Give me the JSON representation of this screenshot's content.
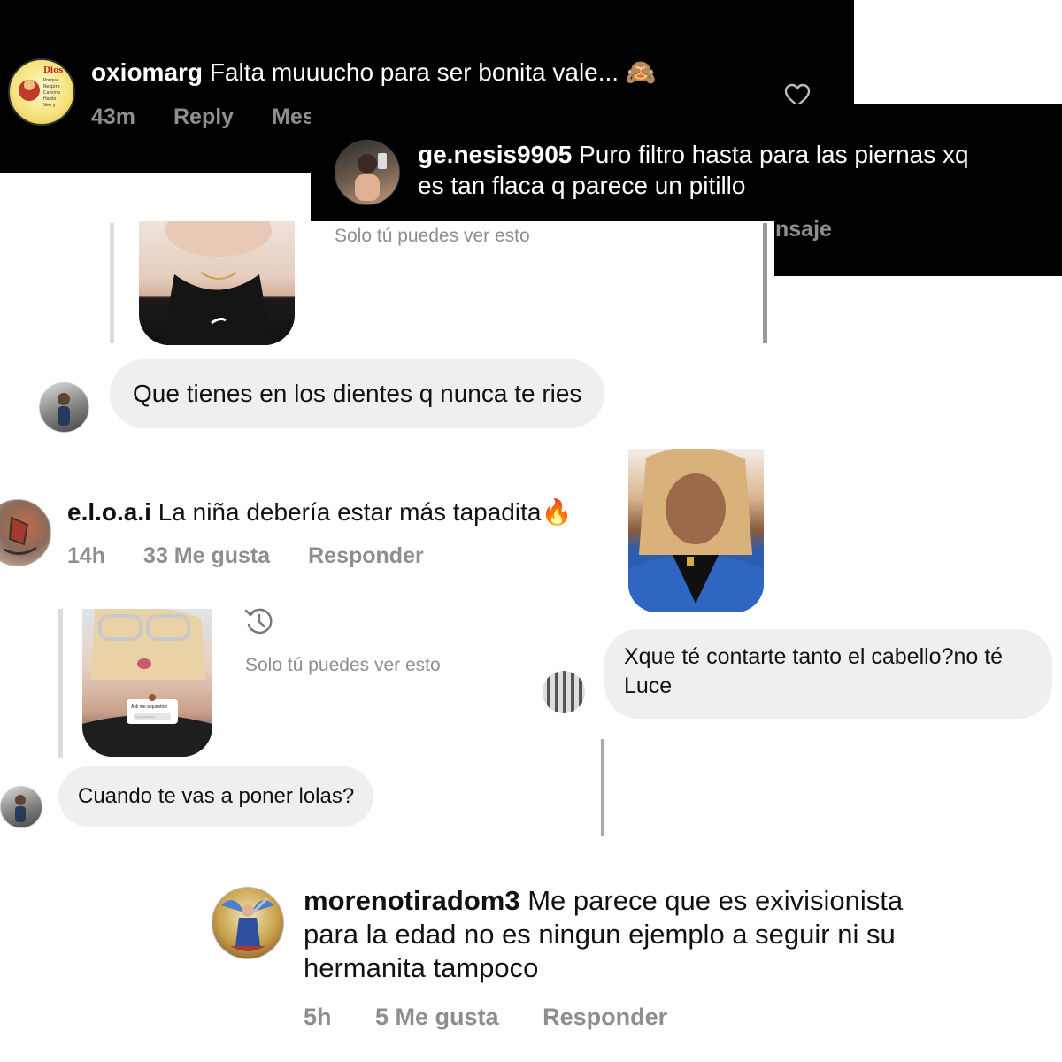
{
  "colors": {
    "dark_bg": "#000000",
    "bubble_bg": "#efefef",
    "muted": "#8e8e8e",
    "text_dark": "#111111"
  },
  "comment1": {
    "username": "oxiomarg",
    "text": "Falta muuucho para ser bonita vale...",
    "emoji": "🙈",
    "time": "43m",
    "reply": "Reply",
    "message": "Mes",
    "avatar_lines": [
      "Gracias",
      "Dios",
      "Porque",
      "Respiro",
      "Camino",
      "Hablo",
      "Veo y",
      "Porque me",
      "Regalas",
      "un día",
      "de vida"
    ],
    "icons": {
      "like": "heart-outline-icon"
    }
  },
  "comment2": {
    "username": "ge.nesis9905",
    "text_line1": "Puro filtro hasta para las piernas xq",
    "text_line2": "es tan flaca q parece un pitillo",
    "partial_meta": "nsaje"
  },
  "story_reply1": {
    "note": "Solo tú puedes ver esto",
    "message": "Que tienes en los dientes q nunca te ries"
  },
  "comment3": {
    "username": "e.l.o.a.i",
    "text": "La niña debería estar más tapadita",
    "emoji": "🔥",
    "time": "14h",
    "likes": "33 Me gusta",
    "reply": "Responder"
  },
  "story_reply2": {
    "note": "Solo tú puedes ver esto",
    "message": "Cuando te vas a poner lolas?",
    "story_sticker_title": "Ask me a question",
    "story_sticker_input": "Type something..."
  },
  "dm_message": {
    "line1": "Xque té contarte tanto el cabello?no té",
    "line2": "Luce"
  },
  "comment4": {
    "username": "morenotiradom3",
    "text_line1": "Me parece que es exivisionista",
    "text_line2": "para la edad no es ningun ejemplo a seguir ni su",
    "text_line3": "hermanita tampoco",
    "time": "5h",
    "likes": "5 Me gusta",
    "reply": "Responder"
  }
}
